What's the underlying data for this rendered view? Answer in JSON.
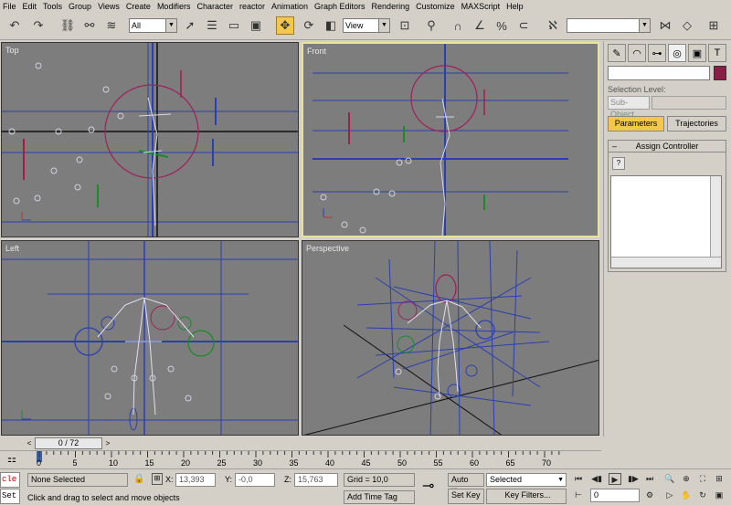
{
  "menu": [
    "File",
    "Edit",
    "Tools",
    "Group",
    "Views",
    "Create",
    "Modifiers",
    "Character",
    "reactor",
    "Animation",
    "Graph Editors",
    "Rendering",
    "Customize",
    "MAXScript",
    "Help"
  ],
  "toolbar": {
    "selection_filter": "All",
    "reference_coord": "View",
    "named_selection": ""
  },
  "viewports": {
    "top_label": "Top",
    "front_label": "Front",
    "left_label": "Left",
    "perspective_label": "Perspective"
  },
  "command_panel": {
    "selection_level_label": "Selection Level:",
    "subobject_label": "Sub-Object",
    "parameters_tab": "Parameters",
    "trajectories_tab": "Trajectories",
    "assign_controller_label": "Assign Controller",
    "name_value": "",
    "color": "#8a1d46"
  },
  "timeslider": {
    "frame_display": "0 / 72",
    "prev_arrow": "<",
    "next_arrow": ">"
  },
  "trackbar": {
    "ticks": [
      "0",
      "5",
      "10",
      "15",
      "20",
      "25",
      "30",
      "35",
      "40",
      "45",
      "50",
      "55",
      "60",
      "65",
      "70"
    ]
  },
  "status": {
    "maxscript_top": "cle",
    "maxscript_bottom": "Set",
    "selection_status": "None Selected",
    "prompt": "Click and drag to select and move objects",
    "x_label": "X:",
    "x_value": "13,393",
    "y_label": "Y:",
    "y_value": "-0,0",
    "z_label": "Z:",
    "z_value": "15,763",
    "grid": "Grid = 10,0",
    "add_time_tag": "Add Time Tag",
    "auto_key": "Auto Key",
    "set_key": "Set Key",
    "key_mode": "Selected",
    "key_filters": "Key Filters...",
    "current_frame": "0"
  }
}
